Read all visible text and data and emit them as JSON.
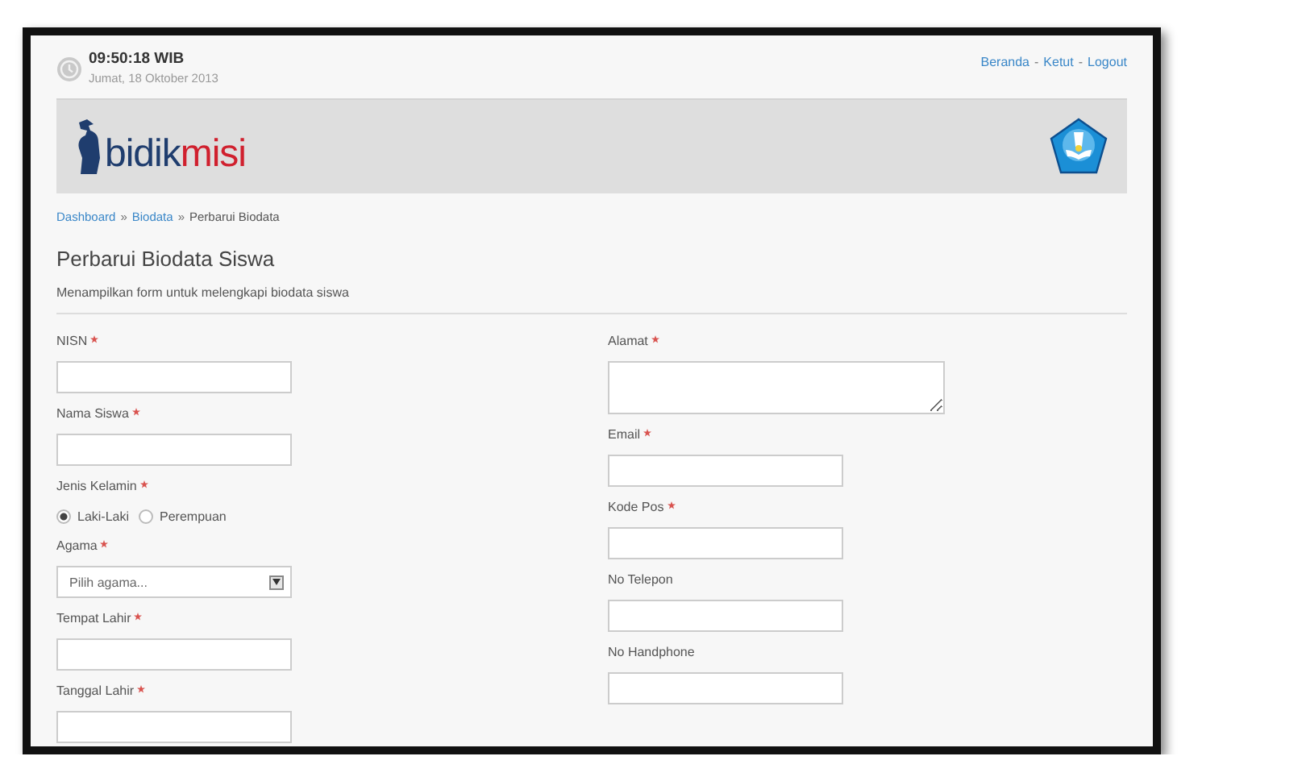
{
  "header": {
    "time": "09:50:18 WIB",
    "date": "Jumat, 18 Oktober 2013",
    "links": [
      {
        "label": "Beranda",
        "kind": "link"
      },
      {
        "label": "-",
        "kind": "separator"
      },
      {
        "label": "Ketut",
        "kind": "link"
      },
      {
        "label": "-",
        "kind": "separator"
      },
      {
        "label": "Logout",
        "kind": "link"
      }
    ]
  },
  "banner": {
    "logo_part_1": "bidik",
    "logo_part_2": "misi"
  },
  "breadcrumb": [
    {
      "label": "Dashboard",
      "kind": "link"
    },
    {
      "label": "»",
      "kind": "separator"
    },
    {
      "label": "Biodata",
      "kind": "link"
    },
    {
      "label": "»",
      "kind": "separator"
    },
    {
      "label": "Perbarui Biodata",
      "kind": "current"
    }
  ],
  "page": {
    "title": "Perbarui Biodata Siswa",
    "subtitle": "Menampilkan form untuk melengkapi biodata siswa"
  },
  "form": {
    "left_column": [
      {
        "label": "NISN",
        "required": true,
        "kind": "text"
      },
      {
        "label": "Nama Siswa",
        "required": true,
        "kind": "text"
      },
      {
        "label": "Jenis Kelamin",
        "required": true,
        "kind": "radio",
        "options": [
          {
            "label": "Laki-Laki",
            "selected": true
          },
          {
            "label": "Perempuan",
            "selected": false
          }
        ]
      },
      {
        "label": "Agama",
        "required": true,
        "kind": "select",
        "placeholder": "Pilih agama..."
      },
      {
        "label": "Tempat Lahir",
        "required": true,
        "kind": "text"
      },
      {
        "label": "Tanggal Lahir",
        "required": true,
        "kind": "text"
      }
    ],
    "right_column": [
      {
        "label": "Alamat",
        "required": true,
        "kind": "textarea"
      },
      {
        "label": "Email",
        "required": true,
        "kind": "text"
      },
      {
        "label": "Kode Pos",
        "required": true,
        "kind": "text"
      },
      {
        "label": "No Telepon",
        "required": false,
        "kind": "text"
      },
      {
        "label": "No Handphone",
        "required": false,
        "kind": "text"
      }
    ]
  }
}
